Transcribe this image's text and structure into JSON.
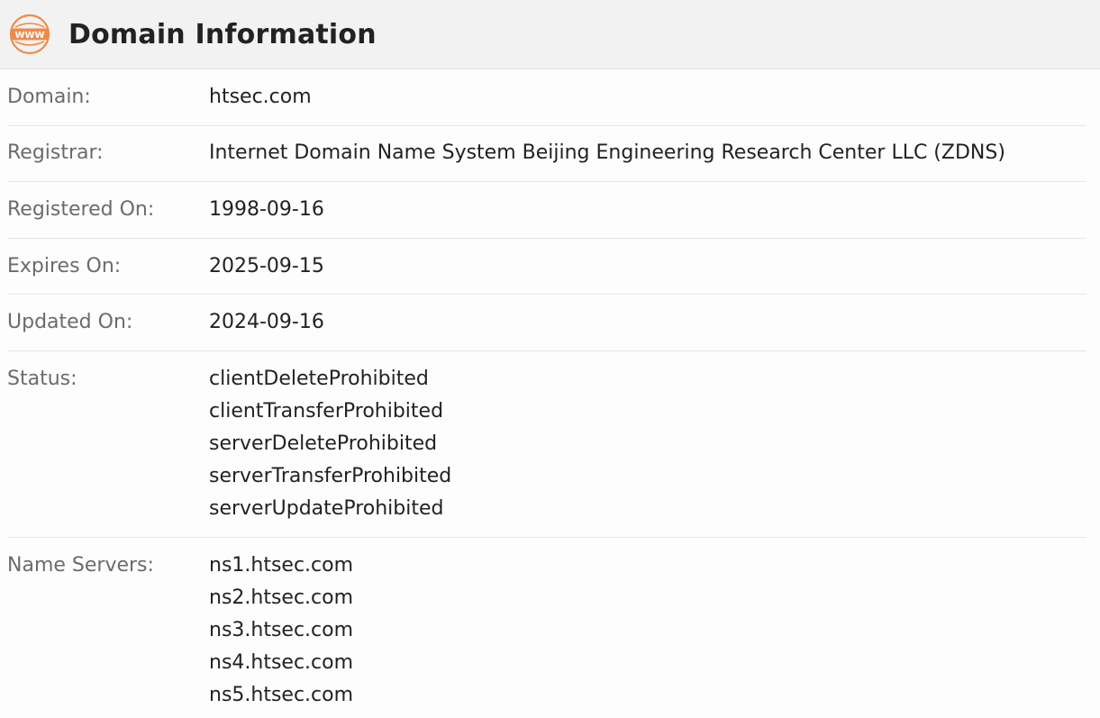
{
  "header": {
    "title": "Domain Information",
    "icon": "www-globe-icon",
    "icon_text": "WWW",
    "icon_color": "#f08a4b"
  },
  "fields": {
    "domain": {
      "label": "Domain:",
      "value": "htsec.com"
    },
    "registrar": {
      "label": "Registrar:",
      "value": "Internet Domain Name System Beijing Engineering Research Center LLC (ZDNS)"
    },
    "registered_on": {
      "label": "Registered On:",
      "value": "1998-09-16"
    },
    "expires_on": {
      "label": "Expires On:",
      "value": "2025-09-15"
    },
    "updated_on": {
      "label": "Updated On:",
      "value": "2024-09-16"
    },
    "status": {
      "label": "Status:",
      "values": [
        "clientDeleteProhibited",
        "clientTransferProhibited",
        "serverDeleteProhibited",
        "serverTransferProhibited",
        "serverUpdateProhibited"
      ]
    },
    "name_servers": {
      "label": "Name Servers:",
      "values": [
        "ns1.htsec.com",
        "ns2.htsec.com",
        "ns3.htsec.com",
        "ns4.htsec.com",
        "ns5.htsec.com"
      ]
    }
  }
}
